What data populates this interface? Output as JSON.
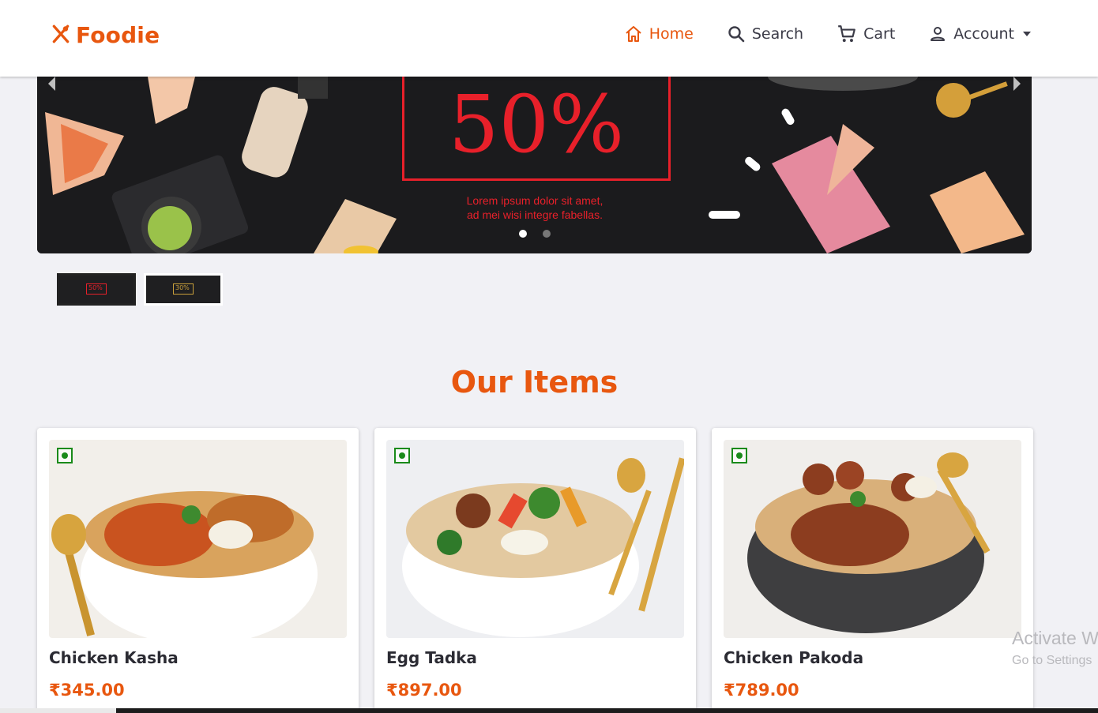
{
  "header": {
    "logo_text": "Foodie",
    "nav": [
      {
        "label": "Home",
        "icon": "home-icon",
        "active": true
      },
      {
        "label": "Search",
        "icon": "search-icon",
        "active": false
      },
      {
        "label": "Cart",
        "icon": "cart-icon",
        "active": false
      },
      {
        "label": "Account",
        "icon": "person-icon",
        "active": false
      }
    ]
  },
  "banner": {
    "discount": "50%",
    "subtitle_line1": "Lorem ipsum dolor sit amet,",
    "subtitle_line2": "ad mei wisi integre fabellas.",
    "active_slide": 1,
    "slide_count": 2,
    "thumbnails": [
      "50%",
      "30%"
    ]
  },
  "section": {
    "title": "Our Items"
  },
  "items": [
    {
      "name": "Chicken Kasha",
      "price": "₹345.00"
    },
    {
      "name": "Egg Tadka",
      "price": "₹897.00"
    },
    {
      "name": "Chicken Pakoda",
      "price": "₹789.00"
    }
  ],
  "watermark": {
    "line1": "Activate W",
    "line2": "Go to Settings"
  },
  "colors": {
    "accent": "#e8570f",
    "promo_red": "#e8202a",
    "veg_green": "#1a8a1a"
  }
}
